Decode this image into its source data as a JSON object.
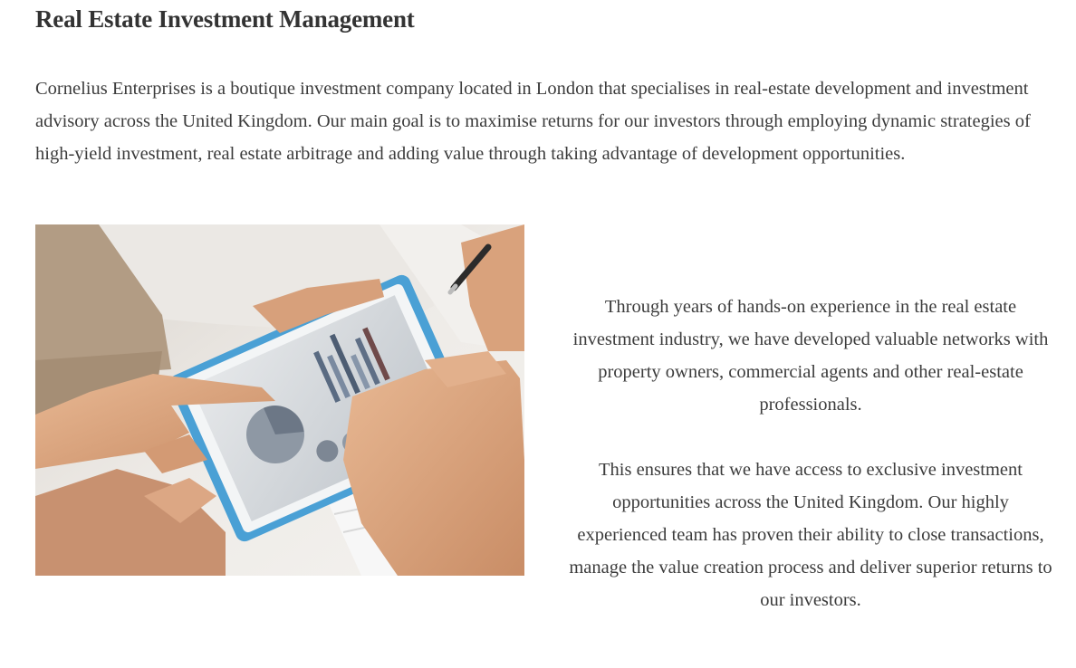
{
  "section": {
    "heading": "Real Estate Investment Management",
    "intro": "Cornelius Enterprises is a boutique investment company located in London that specialises in real-estate development and investment advisory across the United Kingdom. Our main goal is to maximise returns for our investors through employing dynamic strategies of high-yield investment, real estate arbitrage and adding value through taking advantage of development opportunities.",
    "paragraphs": [
      "Through years of hands-on experience in the real estate investment industry, we have developed valuable networks with property owners, commercial agents and other real-estate professionals.",
      "This ensures that we have access to exclusive investment opportunities across the United Kingdom. Our highly experienced team has proven their ability to close transactions, manage the value creation process and deliver superior returns to our investors."
    ]
  },
  "image": {
    "subject": "hands-pointing-at-tablet-with-charts",
    "colors": {
      "background": "#e9e6e2",
      "tablet_frame": "#4fa3d6",
      "screen": "#cfd4da",
      "skin": "#d9a27c",
      "sleeve": "#b8a48c"
    }
  }
}
